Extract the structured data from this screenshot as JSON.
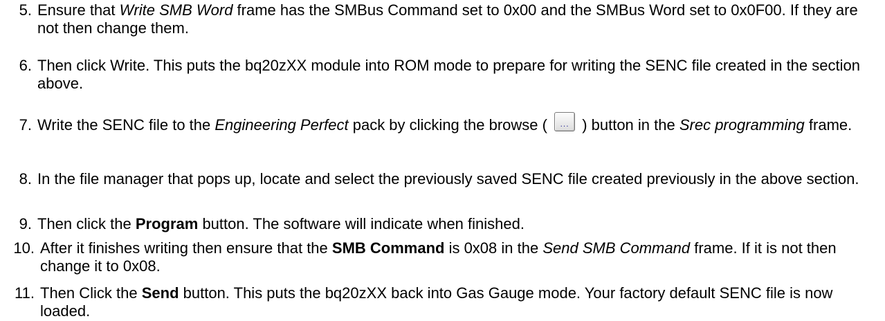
{
  "steps": [
    {
      "num": "5.",
      "parts": [
        {
          "t": "Ensure that "
        },
        {
          "t": "Write SMB Word",
          "s": "i"
        },
        {
          "t": " frame has the SMBus Command set to 0x00 and the SMBus Word set to 0x0F00. If they are not then change them."
        }
      ]
    },
    {
      "num": "6.",
      "parts": [
        {
          "t": "Then click Write. This puts the bq20zXX module into ROM mode to prepare for writing the SENC file created in the section above."
        }
      ]
    },
    {
      "num": "7.",
      "parts": [
        {
          "t": "Write the SENC file to the "
        },
        {
          "t": "Engineering Perfect",
          "s": "i"
        },
        {
          "t": " pack by clicking the browse ( "
        },
        {
          "btn": "browse",
          "label": "..."
        },
        {
          "t": " ) button in the "
        },
        {
          "t": "Srec programming",
          "s": "i"
        },
        {
          "t": " frame."
        }
      ]
    },
    {
      "num": "8.",
      "parts": [
        {
          "t": "In the file manager that pops up, locate and select the previously saved SENC file created previously in the above section."
        }
      ]
    },
    {
      "num": "9.",
      "parts": [
        {
          "t": "Then click the "
        },
        {
          "t": "Program",
          "s": "b"
        },
        {
          "t": " button. The software will indicate when finished."
        }
      ]
    },
    {
      "num": "10.",
      "parts": [
        {
          "t": "After it finishes writing then ensure that the "
        },
        {
          "t": "SMB Command",
          "s": "b"
        },
        {
          "t": " is 0x08 in the "
        },
        {
          "t": "Send SMB Command",
          "s": "i"
        },
        {
          "t": " frame. If it is not then change it to 0x08."
        }
      ]
    },
    {
      "num": "11.",
      "parts": [
        {
          "t": "Then Click the "
        },
        {
          "t": "Send",
          "s": "b"
        },
        {
          "t": " button. This puts the bq20zXX back into Gas Gauge mode. Your factory default SENC file is now loaded."
        }
      ]
    }
  ]
}
